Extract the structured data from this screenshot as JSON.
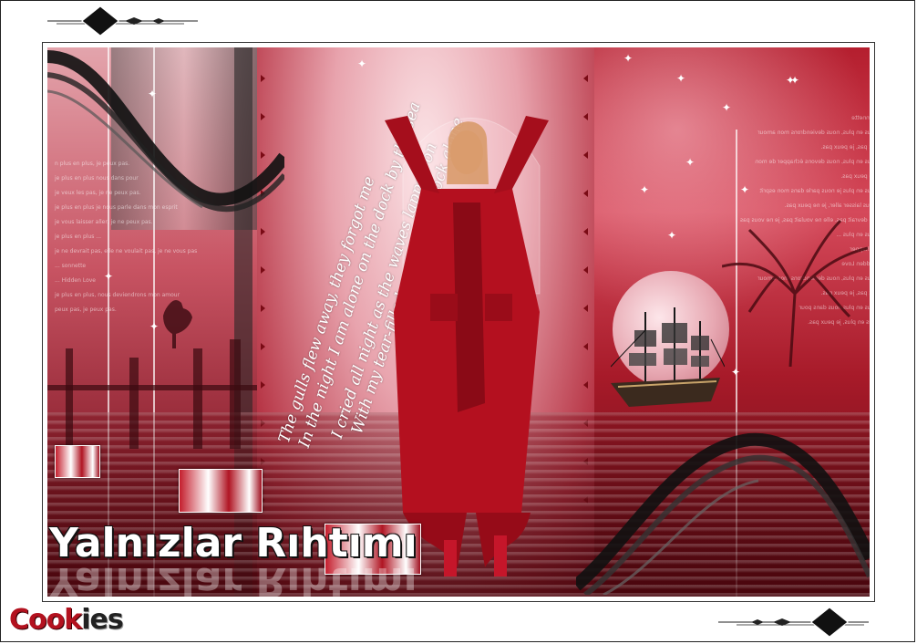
{
  "artwork": {
    "title": "Yalnızlar Rıhtımı",
    "poem_lines": [
      "The gulls flew away, they forgot me",
      "In the night I am alone on the dock by the sea",
      "I cried all night as the waves lapped on",
      "With my tear-filled eyes on the dock alone"
    ],
    "filler_text": [
      "n plus en plus, je peux pas.",
      "je plus en plus nous dans pour",
      "je veux les pas, je ne peux pas.",
      "je plus en plus je nous parle dans mon esprit",
      "je vous laisser aller, je ne peux pas.",
      "je plus en plus ...",
      "je ne devrait pas, elle ne voulait pas, je ne vous pas",
      "... sonnette",
      "... Hidden Love",
      "je plus en plus, nous deviendrons mon amour",
      "peux pas, je peux pas.",
      "je plus en plus, nous devons échapper de mon",
      "je ne peux pas.",
      "... échapper"
    ],
    "colors": {
      "accent_red": "#b41e2e",
      "dark_red": "#5a0a12",
      "highlight": "#ffffff"
    }
  },
  "branding": {
    "logo_part1": "Cook",
    "logo_part2": "ies"
  }
}
